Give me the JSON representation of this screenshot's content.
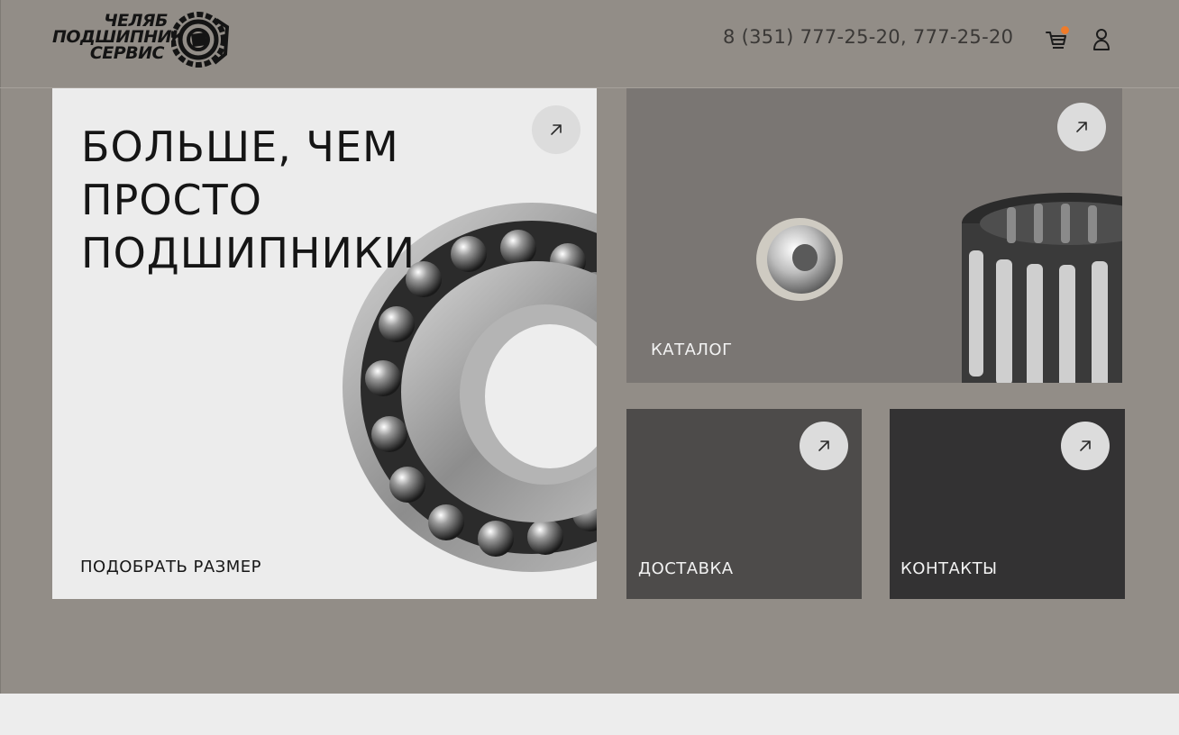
{
  "header": {
    "logo_lines": [
      "ЧЕЛЯБ",
      "ПОДШИПНИК",
      "СЕРВИС"
    ],
    "phone": "8 (351) 777-25-20, 777-25-20",
    "cart_icon": "cart-icon",
    "user_icon": "user-icon",
    "cart_badge_color": "#ef7b2a"
  },
  "cards": {
    "main": {
      "title_lines": [
        "БОЛЬШЕ, ЧЕМ",
        "ПРОСТО",
        "ПОДШИПНИКИ"
      ],
      "link_label": "ПОДОБРАТЬ РАЗМЕР",
      "arrow_icon": "arrow-up-right-icon"
    },
    "catalog": {
      "label": "КАТАЛОГ",
      "arrow_icon": "arrow-up-right-icon"
    },
    "delivery": {
      "label": "ДОСТАВКА",
      "arrow_icon": "arrow-up-right-icon"
    },
    "contacts": {
      "label": "КОНТАКТЫ",
      "arrow_icon": "arrow-up-right-icon"
    }
  },
  "colors": {
    "page_bg": "#928d87",
    "main_card": "#ececec",
    "catalog_card": "#7a7673",
    "delivery_card": "#4d4b4a",
    "contacts_card": "#333233",
    "accent": "#ef7b2a"
  }
}
